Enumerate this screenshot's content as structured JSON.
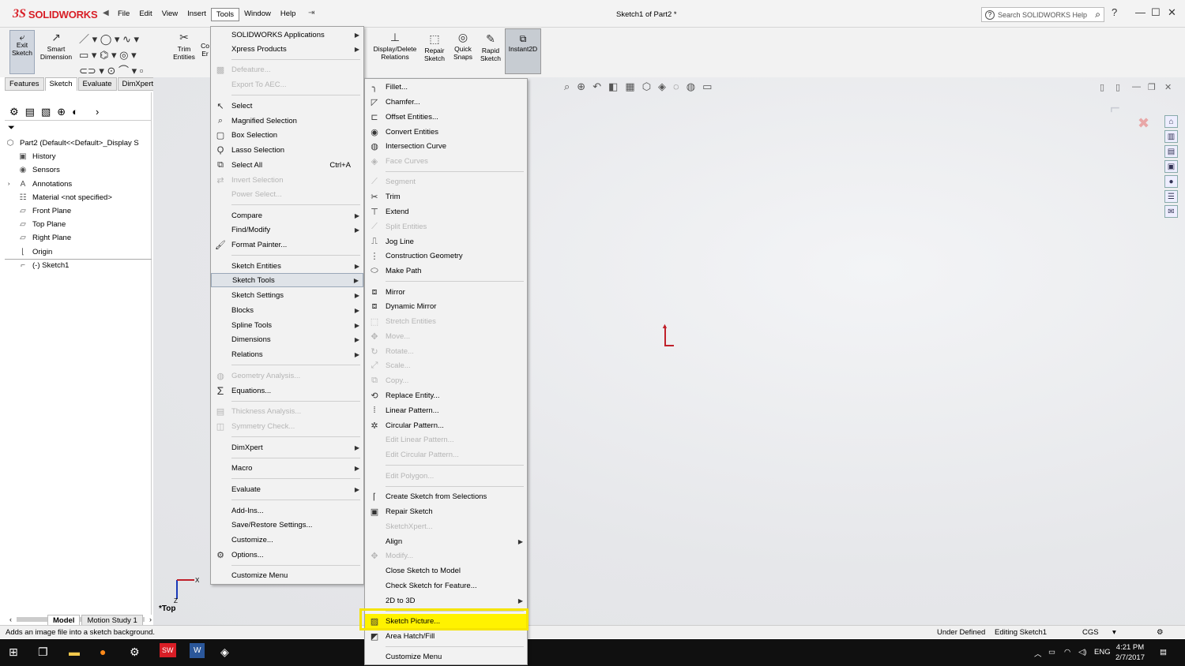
{
  "app": {
    "logo_ds": "3S",
    "logo_name": "SOLIDWORKS",
    "document_title": "Sketch1 of Part2 *",
    "menus": [
      "File",
      "Edit",
      "View",
      "Insert",
      "Tools",
      "Window",
      "Help"
    ],
    "search_placeholder": "Search SOLIDWORKS Help"
  },
  "command_manager": {
    "exit_sketch": "Exit Sketch",
    "smart_dimension": "Smart Dimension",
    "trim_entities": "Trim Entities",
    "convert_partial": "Co Er",
    "display_delete_relations": "Display/Delete Relations",
    "repair_sketch": "Repair Sketch",
    "quick_snaps": "Quick Snaps",
    "rapid_sketch": "Rapid Sketch",
    "instant2d": "Instant2D"
  },
  "tabs": [
    "Features",
    "Sketch",
    "Evaluate",
    "DimXpert"
  ],
  "tree": [
    {
      "label": "Part2  (Default<<Default>_Display S"
    },
    {
      "label": "History"
    },
    {
      "label": "Sensors"
    },
    {
      "label": "Annotations"
    },
    {
      "label": "Material <not specified>"
    },
    {
      "label": "Front Plane"
    },
    {
      "label": "Top Plane"
    },
    {
      "label": "Right Plane"
    },
    {
      "label": "Origin"
    },
    {
      "label": "(-) Sketch1"
    }
  ],
  "bottom_tabs": [
    "Model",
    "Motion Study 1"
  ],
  "view_label": "*Top",
  "status": {
    "hint": "Adds an image file into a sketch background.",
    "state": "Under Defined",
    "mode": "Editing Sketch1",
    "units": "CGS"
  },
  "taskbar": {
    "lang": "ENG",
    "time": "4:21 PM",
    "date": "2/7/2017"
  },
  "tools_menu": [
    {
      "label": "SOLIDWORKS Applications",
      "submenu": true
    },
    {
      "label": "Xpress Products",
      "submenu": true
    },
    {
      "label": "Defeature...",
      "disabled": true
    },
    {
      "label": "Export To AEC...",
      "disabled": true
    },
    {
      "label": "Select"
    },
    {
      "label": "Magnified Selection"
    },
    {
      "label": "Box Selection"
    },
    {
      "label": "Lasso Selection"
    },
    {
      "label": "Select All",
      "shortcut": "Ctrl+A"
    },
    {
      "label": "Invert Selection",
      "disabled": true
    },
    {
      "label": "Power Select...",
      "disabled": true
    },
    {
      "label": "Compare",
      "submenu": true
    },
    {
      "label": "Find/Modify",
      "submenu": true
    },
    {
      "label": "Format Painter..."
    },
    {
      "label": "Sketch Entities",
      "submenu": true
    },
    {
      "label": "Sketch Tools",
      "submenu": true
    },
    {
      "label": "Sketch Settings",
      "submenu": true
    },
    {
      "label": "Blocks",
      "submenu": true
    },
    {
      "label": "Spline Tools",
      "submenu": true
    },
    {
      "label": "Dimensions",
      "submenu": true
    },
    {
      "label": "Relations",
      "submenu": true
    },
    {
      "label": "Geometry Analysis...",
      "disabled": true
    },
    {
      "label": "Equations..."
    },
    {
      "label": "Thickness Analysis...",
      "disabled": true
    },
    {
      "label": "Symmetry Check...",
      "disabled": true
    },
    {
      "label": "DimXpert",
      "submenu": true
    },
    {
      "label": "Macro",
      "submenu": true
    },
    {
      "label": "Evaluate",
      "submenu": true
    },
    {
      "label": "Add-Ins..."
    },
    {
      "label": "Save/Restore Settings..."
    },
    {
      "label": "Customize..."
    },
    {
      "label": "Options..."
    },
    {
      "label": "Customize Menu"
    }
  ],
  "sketch_tools_menu": [
    {
      "label": "Fillet..."
    },
    {
      "label": "Chamfer..."
    },
    {
      "label": "Offset Entities..."
    },
    {
      "label": "Convert Entities"
    },
    {
      "label": "Intersection Curve"
    },
    {
      "label": "Face Curves",
      "disabled": true
    },
    {
      "label": "Segment",
      "disabled": true
    },
    {
      "label": "Trim"
    },
    {
      "label": "Extend"
    },
    {
      "label": "Split Entities",
      "disabled": true
    },
    {
      "label": "Jog Line"
    },
    {
      "label": "Construction Geometry"
    },
    {
      "label": "Make Path"
    },
    {
      "label": "Mirror"
    },
    {
      "label": "Dynamic Mirror"
    },
    {
      "label": "Stretch Entities",
      "disabled": true
    },
    {
      "label": "Move...",
      "disabled": true
    },
    {
      "label": "Rotate...",
      "disabled": true
    },
    {
      "label": "Scale...",
      "disabled": true
    },
    {
      "label": "Copy...",
      "disabled": true
    },
    {
      "label": "Replace Entity..."
    },
    {
      "label": "Linear Pattern..."
    },
    {
      "label": "Circular Pattern..."
    },
    {
      "label": "Edit Linear Pattern...",
      "disabled": true
    },
    {
      "label": "Edit Circular Pattern...",
      "disabled": true
    },
    {
      "label": "Edit Polygon...",
      "disabled": true
    },
    {
      "label": "Create Sketch from Selections"
    },
    {
      "label": "Repair Sketch"
    },
    {
      "label": "SketchXpert...",
      "disabled": true
    },
    {
      "label": "Align",
      "submenu": true
    },
    {
      "label": "Modify...",
      "disabled": true
    },
    {
      "label": "Close Sketch to Model"
    },
    {
      "label": "Check Sketch for Feature..."
    },
    {
      "label": "2D to 3D",
      "submenu": true
    },
    {
      "label": "Sketch Picture..."
    },
    {
      "label": "Area Hatch/Fill"
    },
    {
      "label": "Customize Menu"
    }
  ],
  "colors": {
    "brand": "#d81e26",
    "highlight": "#fff200",
    "origin": "#c0202a"
  }
}
